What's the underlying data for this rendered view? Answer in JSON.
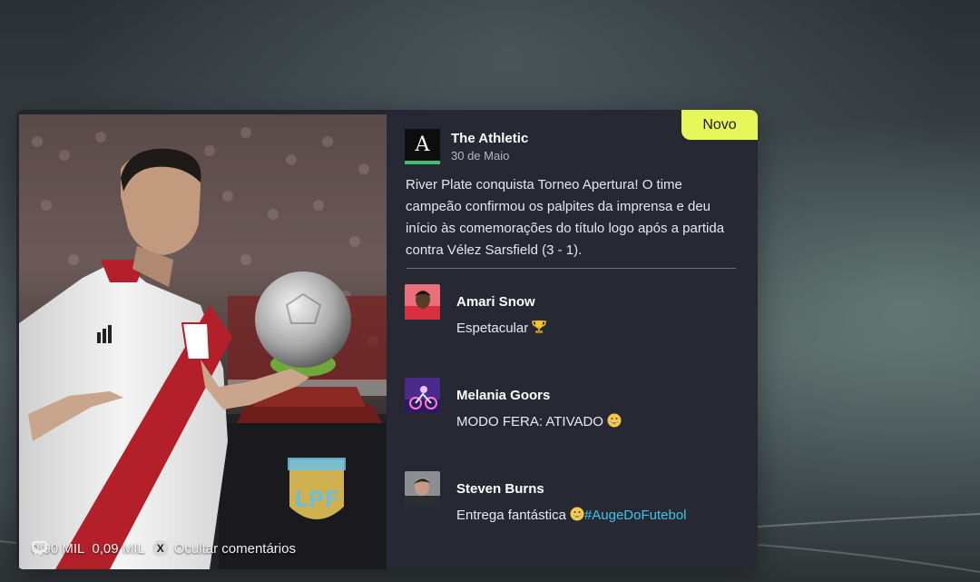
{
  "post": {
    "badge": "Novo",
    "source": {
      "name": "The Athletic",
      "date": "30 de Maio",
      "logo_letter": "A"
    },
    "text": "River Plate conquista Torneo Apertura! O time campeão confirmou os palpites da imprensa e deu início às comemorações do título logo após a partida contra Vélez Sarsfield (3 - 1).",
    "stats": {
      "likes": "0,90 MIL",
      "comments": "0,09 MIL",
      "hide_button_key": "X",
      "hide_label": "Ocultar comentários"
    }
  },
  "comments": [
    {
      "author": "Amari Snow",
      "text": "Espetacular",
      "emoji": "trophy-icon"
    },
    {
      "author": "Melania Goors",
      "text": "MODO FERA: ATIVADO",
      "emoji": "grinning-face-icon"
    },
    {
      "author": "Steven Burns",
      "text": "Entrega fantástica",
      "emoji": "grinning-face-icon",
      "hashtag": "#AugeDoFutebol"
    }
  ],
  "colors": {
    "badge": "#e6f75a",
    "panel": "#262834",
    "hashtag": "#3fc6e6",
    "source_accent": "#3fbf6a"
  }
}
